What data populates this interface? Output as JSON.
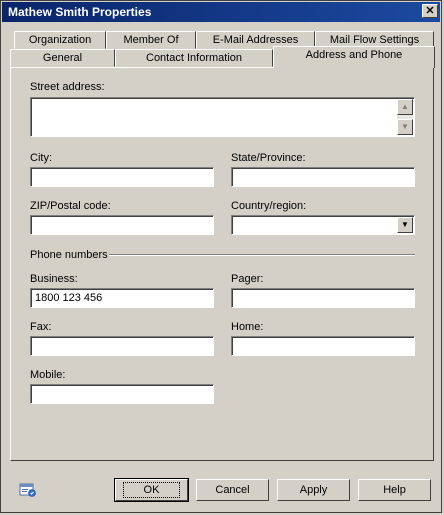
{
  "window": {
    "title": "Mathew Smith Properties",
    "close_label": "✕"
  },
  "tabs_row1": [
    "Organization",
    "Member Of",
    "E-Mail Addresses",
    "Mail Flow Settings"
  ],
  "tabs_row2": [
    "General",
    "Contact Information",
    "Address and Phone"
  ],
  "active_tab": "Address and Phone",
  "address": {
    "street_label": "Street address:",
    "street_value": "",
    "city_label": "City:",
    "city_value": "",
    "state_label": "State/Province:",
    "state_value": "",
    "zip_label": "ZIP/Postal code:",
    "zip_value": "",
    "country_label": "Country/region:",
    "country_value": ""
  },
  "phone": {
    "group_label": "Phone numbers",
    "business_label": "Business:",
    "business_value": "1800 123 456",
    "pager_label": "Pager:",
    "pager_value": "",
    "fax_label": "Fax:",
    "fax_value": "",
    "home_label": "Home:",
    "home_value": "",
    "mobile_label": "Mobile:",
    "mobile_value": ""
  },
  "buttons": {
    "ok": "OK",
    "cancel": "Cancel",
    "apply": "Apply",
    "help": "Help"
  },
  "icons": {
    "help": "help-properties-icon",
    "scroll_up": "▲",
    "scroll_down": "▼",
    "dropdown": "▼"
  }
}
